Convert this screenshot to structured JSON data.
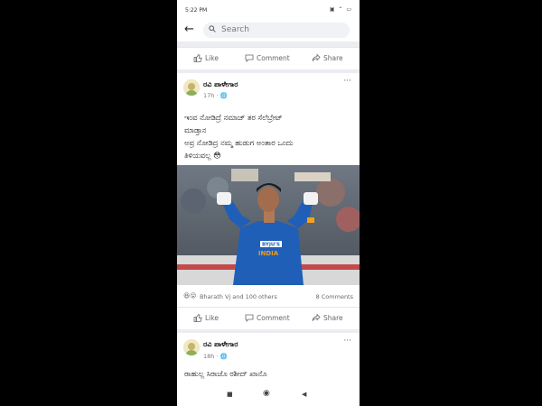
{
  "status": {
    "time": "5:22 PM",
    "icons": "▣ ⌃ ▭"
  },
  "search": {
    "placeholder": "Search"
  },
  "actions": {
    "like": "Like",
    "comment": "Comment",
    "share": "Share"
  },
  "post1": {
    "author": "ರವಿ ಪಾಳೇಗಾರ",
    "time": "17h · ",
    "more": "···",
    "text_lines": [
      "ಇಂವ ನೋಡಿದ್ರೆ ನಮಾಜ್ ತರ ಸೆಲೆಬ್ರೇಟ್",
      "ಮಾಡ್ತಾನ",
      "ಅವ್ರ ನೋಡಿದ್ರ ನಮ್ಮ ಹುಡುಗ ಅಂತಾರ ಒಂದು",
      "ತಿಳಿಯವಲ್ಲ 😳"
    ],
    "jersey_brand": "BYJU'S",
    "jersey_team": "INDIA",
    "reactions": "Bharath Vj and 100 others",
    "comments": "8 Comments"
  },
  "post2": {
    "author": "ರವಿ ಪಾಳೇಗಾರ",
    "time": "18h · ",
    "more": "···",
    "text": "ರಾಹುಲ್ಲ ಸಿರಾಜೊ ರಶೀದ್ ಖಾನೊ"
  },
  "nav": {
    "recent": "■",
    "home": "◉",
    "back": "◀"
  },
  "colors": {
    "accent": "#1877f2",
    "action_gray": "#65676b",
    "divider": "#ebedf0"
  }
}
